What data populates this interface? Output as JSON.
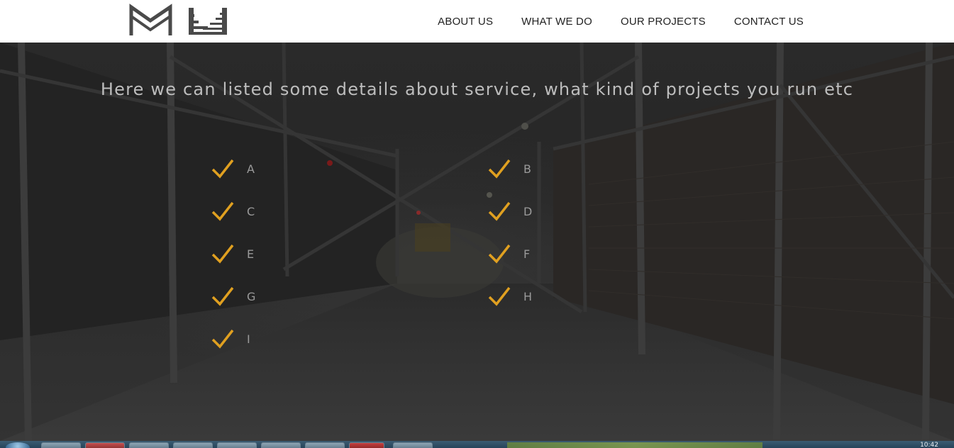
{
  "header": {
    "logo_name": "mm-logo",
    "nav": [
      {
        "label": "ABOUT US"
      },
      {
        "label": "WHAT WE DO"
      },
      {
        "label": "OUR PROJECTS"
      },
      {
        "label": "CONTACT US"
      }
    ]
  },
  "hero": {
    "headline": "Here we can listed some details about service, what kind of projects you run etc",
    "check_color": "#e0a020",
    "features_left": [
      "A",
      "C",
      "E",
      "G",
      "I"
    ],
    "features_right": [
      "B",
      "D",
      "F",
      "H"
    ]
  },
  "taskbar": {
    "clock": "10:42"
  }
}
